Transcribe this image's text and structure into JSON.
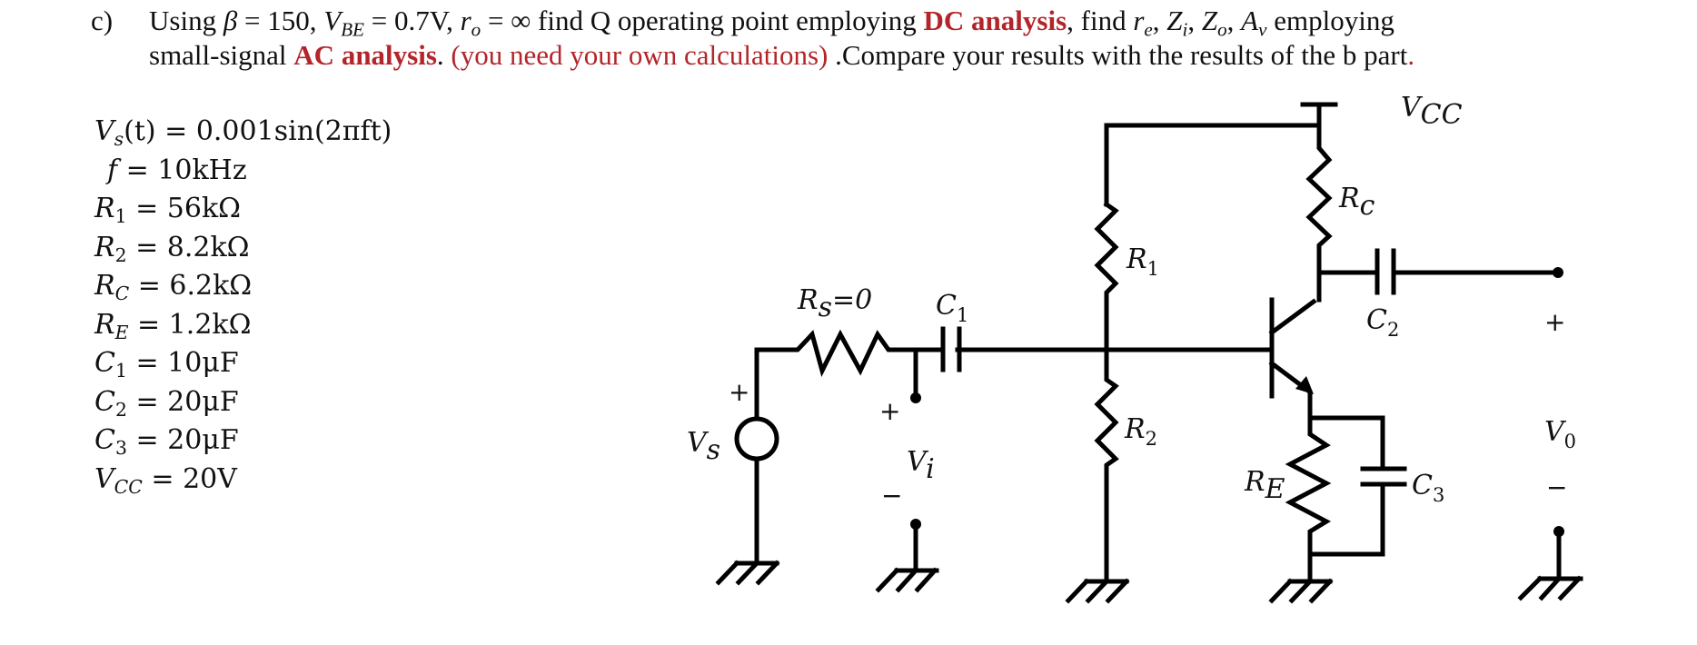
{
  "problem": {
    "part_label": "c)",
    "line1": {
      "t1": "Using ",
      "beta_sym": "β",
      "t2": " = 150, ",
      "vbe_sym": "V",
      "vbe_sub": "BE",
      "t3": " = 0.7V, ",
      "ro_sym": "r",
      "ro_sub": "o",
      "t4": " = ∞ find Q operating point employing ",
      "dc_analysis": "DC analysis",
      "t5": ", find ",
      "re_sym": "r",
      "re_sub": "e",
      "zi_sym": "Z",
      "zi_sub": "i",
      "zo_sym": "Z",
      "zo_sub": "o",
      "av_sym": "A",
      "av_sub": "v",
      "t6": " employing"
    },
    "line2": {
      "t1": "small-signal ",
      "ac_analysis": "AC analysis",
      "t2": ".  ",
      "note": "(you need your own calculations)",
      "t3": " .Compare your results with the results of the b part",
      "t4": "."
    },
    "colors": {
      "emphasis": "#b3252a",
      "text": "#111111"
    }
  },
  "parameters": [
    {
      "sym": "V",
      "sub": "s",
      "rest": "(t) = 0.001sin(2πft)"
    },
    {
      "sym": "f",
      "sub": "",
      "rest": " = 10kHz"
    },
    {
      "sym": "R",
      "sub": "1",
      "rest": " = 56kΩ"
    },
    {
      "sym": "R",
      "sub": "2",
      "rest": " = 8.2kΩ"
    },
    {
      "sym": "R",
      "sub": "C",
      "rest": " = 6.2kΩ"
    },
    {
      "sym": "R",
      "sub": "E",
      "rest": " = 1.2kΩ"
    },
    {
      "sym": "C",
      "sub": "1",
      "rest": " = 10μF"
    },
    {
      "sym": "C",
      "sub": "2",
      "rest": " = 20μF"
    },
    {
      "sym": "C",
      "sub": "3",
      "rest": " = 20μF"
    },
    {
      "sym": "V",
      "sub": "CC",
      "rest": " = 20V"
    }
  ],
  "circuit": {
    "labels": {
      "vcc": {
        "main": "V",
        "sub": "CC"
      },
      "rc": {
        "main": "R",
        "sub": "c"
      },
      "r1": {
        "main": "R",
        "sub": "1"
      },
      "r2": {
        "main": "R",
        "sub": "2"
      },
      "re": {
        "main": "R",
        "sub": "E"
      },
      "c1": {
        "main": "C",
        "sub": "1"
      },
      "c2": {
        "main": "C",
        "sub": "2"
      },
      "c3": {
        "main": "C",
        "sub": "3"
      },
      "rs": {
        "main": "R",
        "sub": "s",
        "rest": "=0"
      },
      "vs": {
        "main": "V",
        "sub": "s"
      },
      "vi": {
        "main": "V",
        "sub": "i"
      },
      "vo": {
        "main": "V",
        "sub": "0"
      }
    },
    "signs": {
      "plus": "+",
      "minus": "−"
    }
  }
}
